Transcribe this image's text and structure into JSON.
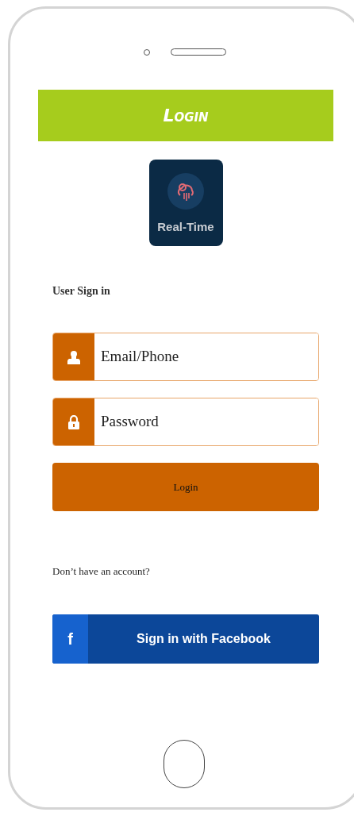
{
  "header": {
    "title": "Login"
  },
  "logo": {
    "text": "Real-Time"
  },
  "form": {
    "heading": "User Sign in",
    "fields": [
      {
        "kind": "user",
        "placeholder": "Email/Phone"
      },
      {
        "kind": "lock",
        "placeholder": "Password"
      }
    ],
    "submit": "Login"
  },
  "signup_prompt": "Don’t have an account?",
  "facebook_button": {
    "icon": "f",
    "label": "Sign in with Facebook"
  }
}
